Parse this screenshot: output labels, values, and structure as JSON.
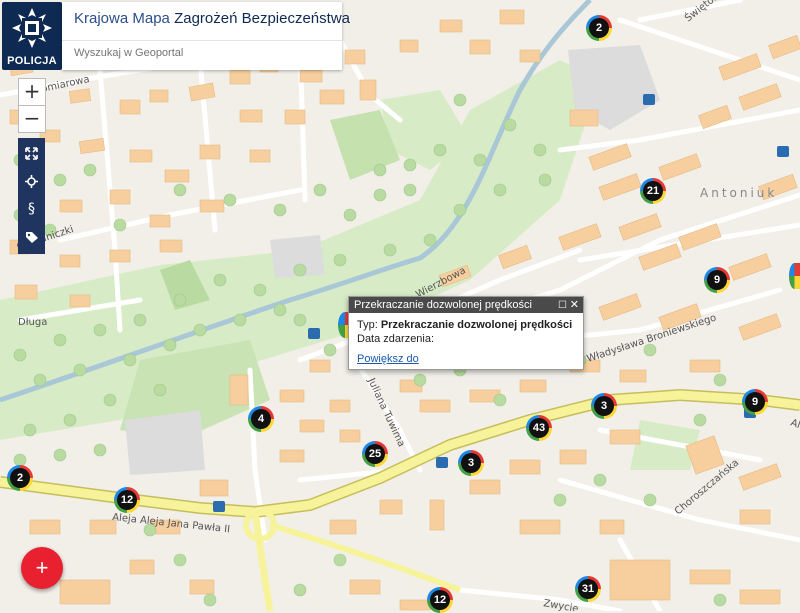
{
  "header": {
    "brand_label": "POLICJA",
    "title_part1": "Krajowa Mapa ",
    "title_part2": "Zagrożeń Bezpieczeństwa",
    "search_placeholder": "Wyszukaj w Geoportal"
  },
  "zoom": {
    "in_label": "+",
    "out_label": "−"
  },
  "tools": {
    "fullscreen_icon": "fullscreen-icon",
    "locate_icon": "locate-icon",
    "legal_icon": "paragraph-icon",
    "tag_icon": "tag-icon"
  },
  "map": {
    "street_labels": {
      "pomiarowa": "omiarowa",
      "ogrodniczki": "Ogrodniczki",
      "dluga": "Długa",
      "wierzbowa": "Wierzbowa",
      "broniewskiego": "Władysława Broniewskiego",
      "tuwima": "Juliana Tuwima",
      "jana_pawla": "Aleja Aleja Jana Pawła II",
      "choroszczanska": "Choroszczańska",
      "zwyciestwa": "Zwycię",
      "swietokrzyska": "Świętokrzyska",
      "antoniuk": "Antoniuk",
      "al_short": "Al"
    },
    "markers": [
      {
        "count": "2"
      },
      {
        "count": "21"
      },
      {
        "count": "9"
      },
      {
        "count": "4"
      },
      {
        "count": "3"
      },
      {
        "count": "43"
      },
      {
        "count": "9"
      },
      {
        "count": "25"
      },
      {
        "count": "3"
      },
      {
        "count": "2"
      },
      {
        "count": "12"
      },
      {
        "count": "31"
      },
      {
        "count": "12"
      }
    ]
  },
  "popup": {
    "title": "Przekraczanie dozwolonej prędkości",
    "type_label": "Typ: ",
    "type_value": "Przekraczanie dozwolonej prędkości",
    "date_label": "Data zdarzenia:",
    "zoom_link": "Powiększ do"
  },
  "fab": {
    "label": "+"
  },
  "colors": {
    "brand_navy": "#0e2a52",
    "river": "#a9c7d6",
    "main_road": "#f6f39b",
    "building": "#f7cf9f",
    "park": "#d7ecc6",
    "fab_red": "#e8202f"
  }
}
